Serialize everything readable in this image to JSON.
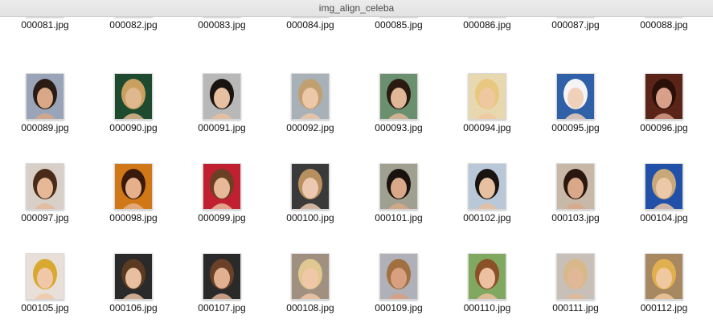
{
  "window": {
    "title": "img_align_celeba"
  },
  "files": [
    {
      "name": "000081.jpg",
      "bg": "#6b4a3a",
      "skin": "#c99a7a",
      "hair": "#2a1a12"
    },
    {
      "name": "000082.jpg",
      "bg": "#3a5a3a",
      "skin": "#d8b08a",
      "hair": "#3b2a1a"
    },
    {
      "name": "000083.jpg",
      "bg": "#a07060",
      "skin": "#e0b090",
      "hair": "#6a4a2a"
    },
    {
      "name": "000084.jpg",
      "bg": "#c08080",
      "skin": "#f0c0a0",
      "hair": "#8a5a3a"
    },
    {
      "name": "000085.jpg",
      "bg": "#806050",
      "skin": "#d9a680",
      "hair": "#4a2a1a"
    },
    {
      "name": "000086.jpg",
      "bg": "#e0a090",
      "skin": "#f0c8a8",
      "hair": "#b08050"
    },
    {
      "name": "000087.jpg",
      "bg": "#505050",
      "skin": "#c89878",
      "hair": "#1a1a1a"
    },
    {
      "name": "000088.jpg",
      "bg": "#d0a030",
      "skin": "#e8b890",
      "hair": "#a06020"
    },
    {
      "name": "000089.jpg",
      "bg": "#9aa4b8",
      "skin": "#d8a888",
      "hair": "#2a1c14"
    },
    {
      "name": "000090.jpg",
      "bg": "#1e4a30",
      "skin": "#e0b890",
      "hair": "#c9a060"
    },
    {
      "name": "000091.jpg",
      "bg": "#b8b8b8",
      "skin": "#e6c0a0",
      "hair": "#1a1410"
    },
    {
      "name": "000092.jpg",
      "bg": "#a8b0b8",
      "skin": "#ecc8a8",
      "hair": "#c0a070"
    },
    {
      "name": "000093.jpg",
      "bg": "#6a9070",
      "skin": "#e0b898",
      "hair": "#2a1a12"
    },
    {
      "name": "000094.jpg",
      "bg": "#e8d8b0",
      "skin": "#f0c8a0",
      "hair": "#e8c880"
    },
    {
      "name": "000095.jpg",
      "bg": "#3060a8",
      "skin": "#f0d0b8",
      "hair": "#f4f4f4"
    },
    {
      "name": "000096.jpg",
      "bg": "#5a2418",
      "skin": "#d8a088",
      "hair": "#2a1008"
    },
    {
      "name": "000097.jpg",
      "bg": "#d8d0c8",
      "skin": "#e6b898",
      "hair": "#4a2a18"
    },
    {
      "name": "000098.jpg",
      "bg": "#d07818",
      "skin": "#e6b08a",
      "hair": "#3a1a0a"
    },
    {
      "name": "000099.jpg",
      "bg": "#c02030",
      "skin": "#e8b898",
      "hair": "#6a4024"
    },
    {
      "name": "000100.jpg",
      "bg": "#3a3a3a",
      "skin": "#ecc8b0",
      "hair": "#b89060"
    },
    {
      "name": "000101.jpg",
      "bg": "#a0a090",
      "skin": "#d8a888",
      "hair": "#1a1210"
    },
    {
      "name": "000102.jpg",
      "bg": "#b8c8d8",
      "skin": "#e6c0a0",
      "hair": "#1a1410"
    },
    {
      "name": "000103.jpg",
      "bg": "#c8b8a8",
      "skin": "#d8a888",
      "hair": "#2a1810"
    },
    {
      "name": "000104.jpg",
      "bg": "#2050a8",
      "skin": "#ecc8a8",
      "hair": "#c8a878"
    },
    {
      "name": "000105.jpg",
      "bg": "#e8e0d8",
      "skin": "#f0c8a8",
      "hair": "#d8a830"
    },
    {
      "name": "000106.jpg",
      "bg": "#2a2a2a",
      "skin": "#e8c0a0",
      "hair": "#5a3a20"
    },
    {
      "name": "000107.jpg",
      "bg": "#2a2a2a",
      "skin": "#e0b090",
      "hair": "#6a4028"
    },
    {
      "name": "000108.jpg",
      "bg": "#a09080",
      "skin": "#f0c8a8",
      "hair": "#e0c890"
    },
    {
      "name": "000109.jpg",
      "bg": "#b0b0b8",
      "skin": "#d8a080",
      "hair": "#a07040"
    },
    {
      "name": "000110.jpg",
      "bg": "#80a860",
      "skin": "#ecc0a0",
      "hair": "#8a5028"
    },
    {
      "name": "000111.jpg",
      "bg": "#c8c0b8",
      "skin": "#e0b898",
      "hair": "#d8b888"
    },
    {
      "name": "000112.jpg",
      "bg": "#a88860",
      "skin": "#f0c8a0",
      "hair": "#e0b050"
    }
  ]
}
